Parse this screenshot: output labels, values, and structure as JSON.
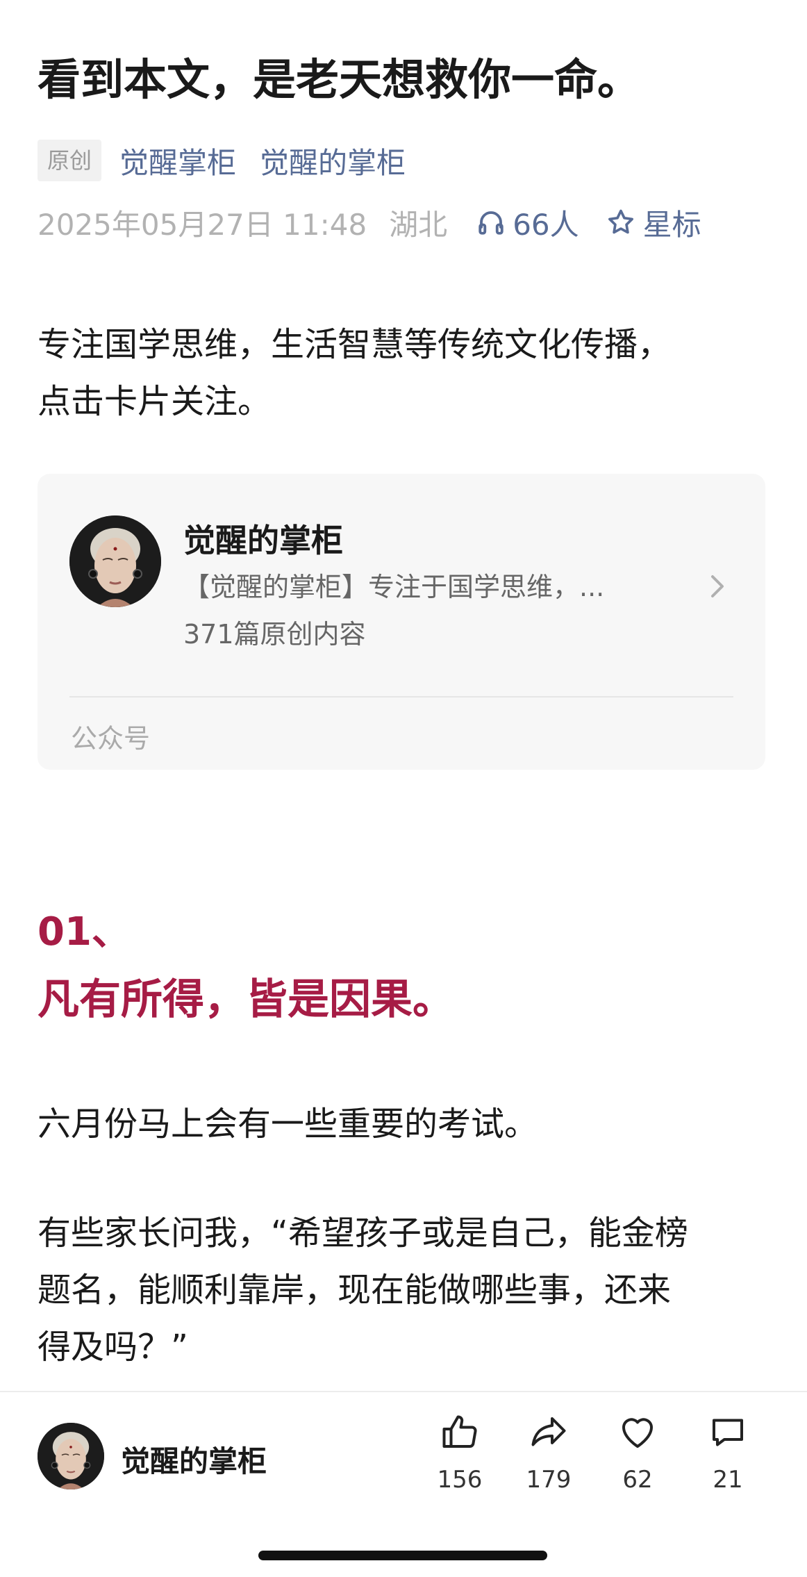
{
  "article": {
    "title": "看到本文，是老天想救你一命。",
    "original_tag": "原创",
    "author_link_1": "觉醒掌柜",
    "author_link_2": "觉醒的掌柜",
    "date": "2025年05月27日 11:48",
    "location": "湖北",
    "listen_count": "66人",
    "star_label": "星标",
    "intro_line1": "专注国学思维，生活智慧等传统文化传播，",
    "intro_line2": "点击卡片关注。"
  },
  "card": {
    "name": "觉醒的掌柜",
    "desc": "【觉醒的掌柜】专注于国学思维，...",
    "count": "371篇原创内容",
    "type": "公众号"
  },
  "section": {
    "number": "01、",
    "title": "凡有所得，皆是因果。"
  },
  "body": {
    "p1": "六月份马上会有一些重要的考试。",
    "p2_line1": "有些家长问我，“希望孩子或是自己，能金榜",
    "p2_line2": "题名，能顺利靠岸，现在能做哪些事，还来",
    "p2_line3": "得及吗？”"
  },
  "bottom_bar": {
    "name": "觉醒的掌柜",
    "like_count": "156",
    "share_count": "179",
    "heart_count": "62",
    "comment_count": "21"
  },
  "colors": {
    "link": "#576b95",
    "accent": "#a61c45",
    "meta_gray": "#b2b2b2"
  }
}
